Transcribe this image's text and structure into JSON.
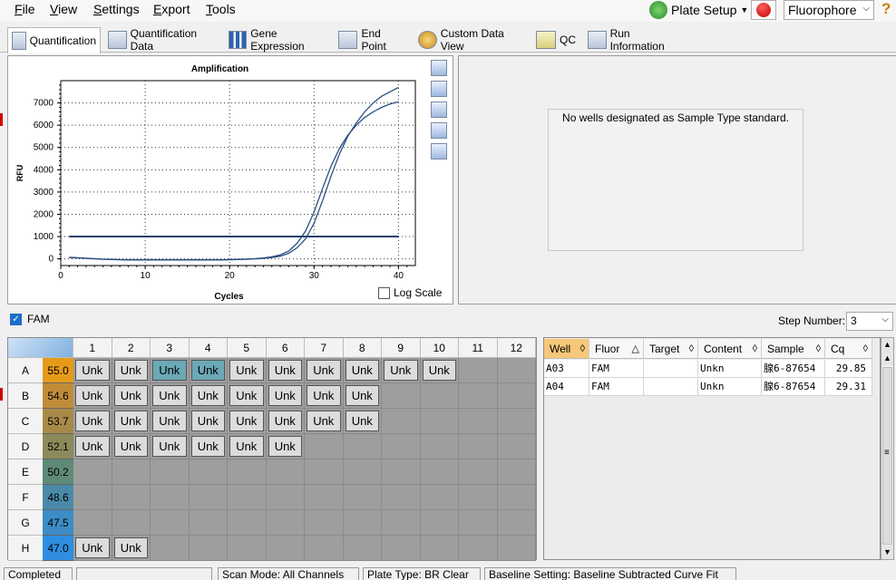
{
  "menu": [
    "File",
    "View",
    "Settings",
    "Export",
    "Tools"
  ],
  "menu_mnemonics": [
    "F",
    "V",
    "S",
    "E",
    "T"
  ],
  "plate_setup_label": "Plate Setup",
  "fluorophore_select": "Fluorophore",
  "help": "?",
  "tabs": [
    "Quantification",
    "Quantification Data",
    "Gene Expression",
    "End Point",
    "Custom Data View",
    "QC",
    "Run Information"
  ],
  "active_tab": "Quantification",
  "chart_data": {
    "type": "line",
    "title": "Amplification",
    "xlabel": "Cycles",
    "ylabel": "RFU",
    "xlim": [
      0,
      42
    ],
    "ylim": [
      -300,
      8000
    ],
    "xticks": [
      0,
      10,
      20,
      30,
      40
    ],
    "yticks": [
      0,
      1000,
      2000,
      3000,
      4000,
      5000,
      6000,
      7000
    ],
    "grid": true,
    "series": [
      {
        "well": "A03",
        "x": [
          1,
          2,
          3,
          4,
          5,
          6,
          7,
          8,
          9,
          10,
          11,
          12,
          13,
          14,
          15,
          16,
          17,
          18,
          19,
          20,
          21,
          22,
          23,
          24,
          25,
          26,
          27,
          28,
          29,
          30,
          31,
          32,
          33,
          34,
          35,
          36,
          37,
          38,
          39,
          40
        ],
        "y": [
          60,
          40,
          20,
          0,
          -20,
          -30,
          -40,
          -50,
          -50,
          -50,
          -50,
          -50,
          -50,
          -50,
          -50,
          -50,
          -50,
          -50,
          -50,
          -40,
          -30,
          -20,
          0,
          20,
          60,
          120,
          250,
          500,
          900,
          1600,
          2600,
          3700,
          4700,
          5500,
          6100,
          6600,
          7000,
          7300,
          7500,
          7700
        ]
      },
      {
        "well": "A04",
        "x": [
          1,
          2,
          3,
          4,
          5,
          6,
          7,
          8,
          9,
          10,
          11,
          12,
          13,
          14,
          15,
          16,
          17,
          18,
          19,
          20,
          21,
          22,
          23,
          24,
          25,
          26,
          27,
          28,
          29,
          30,
          31,
          32,
          33,
          34,
          35,
          36,
          37,
          38,
          39,
          40
        ],
        "y": [
          70,
          50,
          30,
          10,
          -10,
          -20,
          -30,
          -40,
          -40,
          -40,
          -40,
          -40,
          -40,
          -40,
          -40,
          -40,
          -40,
          -40,
          -40,
          -30,
          -20,
          -10,
          10,
          40,
          90,
          180,
          350,
          700,
          1250,
          2100,
          3150,
          4150,
          4950,
          5550,
          6000,
          6350,
          6600,
          6800,
          6950,
          7050
        ]
      }
    ],
    "threshold": 1000
  },
  "log_scale_label": "Log Scale",
  "std_message": "No wells designated as Sample Type standard.",
  "fam_label": "FAM",
  "step_number_label": "Step Number:",
  "step_number_value": "3",
  "plate": {
    "columns": [
      "1",
      "2",
      "3",
      "4",
      "5",
      "6",
      "7",
      "8",
      "9",
      "10",
      "11",
      "12"
    ],
    "rows": [
      {
        "id": "A",
        "temp": "55.0",
        "color": "#e69a1a",
        "wells": [
          "Unk",
          "Unk",
          "Unk",
          "Unk",
          "Unk",
          "Unk",
          "Unk",
          "Unk",
          "Unk",
          "Unk",
          "",
          ""
        ]
      },
      {
        "id": "B",
        "temp": "54.6",
        "color": "#c08c3a",
        "wells": [
          "Unk",
          "Unk",
          "Unk",
          "Unk",
          "Unk",
          "Unk",
          "Unk",
          "Unk",
          "",
          "",
          "",
          ""
        ]
      },
      {
        "id": "C",
        "temp": "53.7",
        "color": "#a88a48",
        "wells": [
          "Unk",
          "Unk",
          "Unk",
          "Unk",
          "Unk",
          "Unk",
          "Unk",
          "Unk",
          "",
          "",
          "",
          ""
        ]
      },
      {
        "id": "D",
        "temp": "52.1",
        "color": "#8a8a5a",
        "wells": [
          "Unk",
          "Unk",
          "Unk",
          "Unk",
          "Unk",
          "Unk",
          "",
          "",
          "",
          "",
          "",
          ""
        ]
      },
      {
        "id": "E",
        "temp": "50.2",
        "color": "#5e8a78",
        "wells": [
          "",
          "",
          "",
          "",
          "",
          "",
          "",
          "",
          "",
          "",
          "",
          ""
        ]
      },
      {
        "id": "F",
        "temp": "48.6",
        "color": "#4a8aa8",
        "wells": [
          "",
          "",
          "",
          "",
          "",
          "",
          "",
          "",
          "",
          "",
          "",
          ""
        ]
      },
      {
        "id": "G",
        "temp": "47.5",
        "color": "#3d8cc6",
        "wells": [
          "",
          "",
          "",
          "",
          "",
          "",
          "",
          "",
          "",
          "",
          "",
          ""
        ]
      },
      {
        "id": "H",
        "temp": "47.0",
        "color": "#2f8ee0",
        "wells": [
          "Unk",
          "Unk",
          "",
          "",
          "",
          "",
          "",
          "",
          "",
          "",
          "",
          ""
        ]
      }
    ],
    "selected": [
      "A3",
      "A4"
    ]
  },
  "results": {
    "headers": [
      "Well",
      "Fluor",
      "Target",
      "Content",
      "Sample",
      "Cq"
    ],
    "rows": [
      [
        "A03",
        "FAM",
        "",
        "Unkn",
        "腺6-87654",
        "29.85"
      ],
      [
        "A04",
        "FAM",
        "",
        "Unkn",
        "腺6-87654",
        "29.31"
      ]
    ]
  },
  "status": [
    "Completed",
    "",
    "Scan Mode: All Channels",
    "Plate Type: BR Clear",
    "Baseline Setting: Baseline Subtracted Curve Fit"
  ]
}
